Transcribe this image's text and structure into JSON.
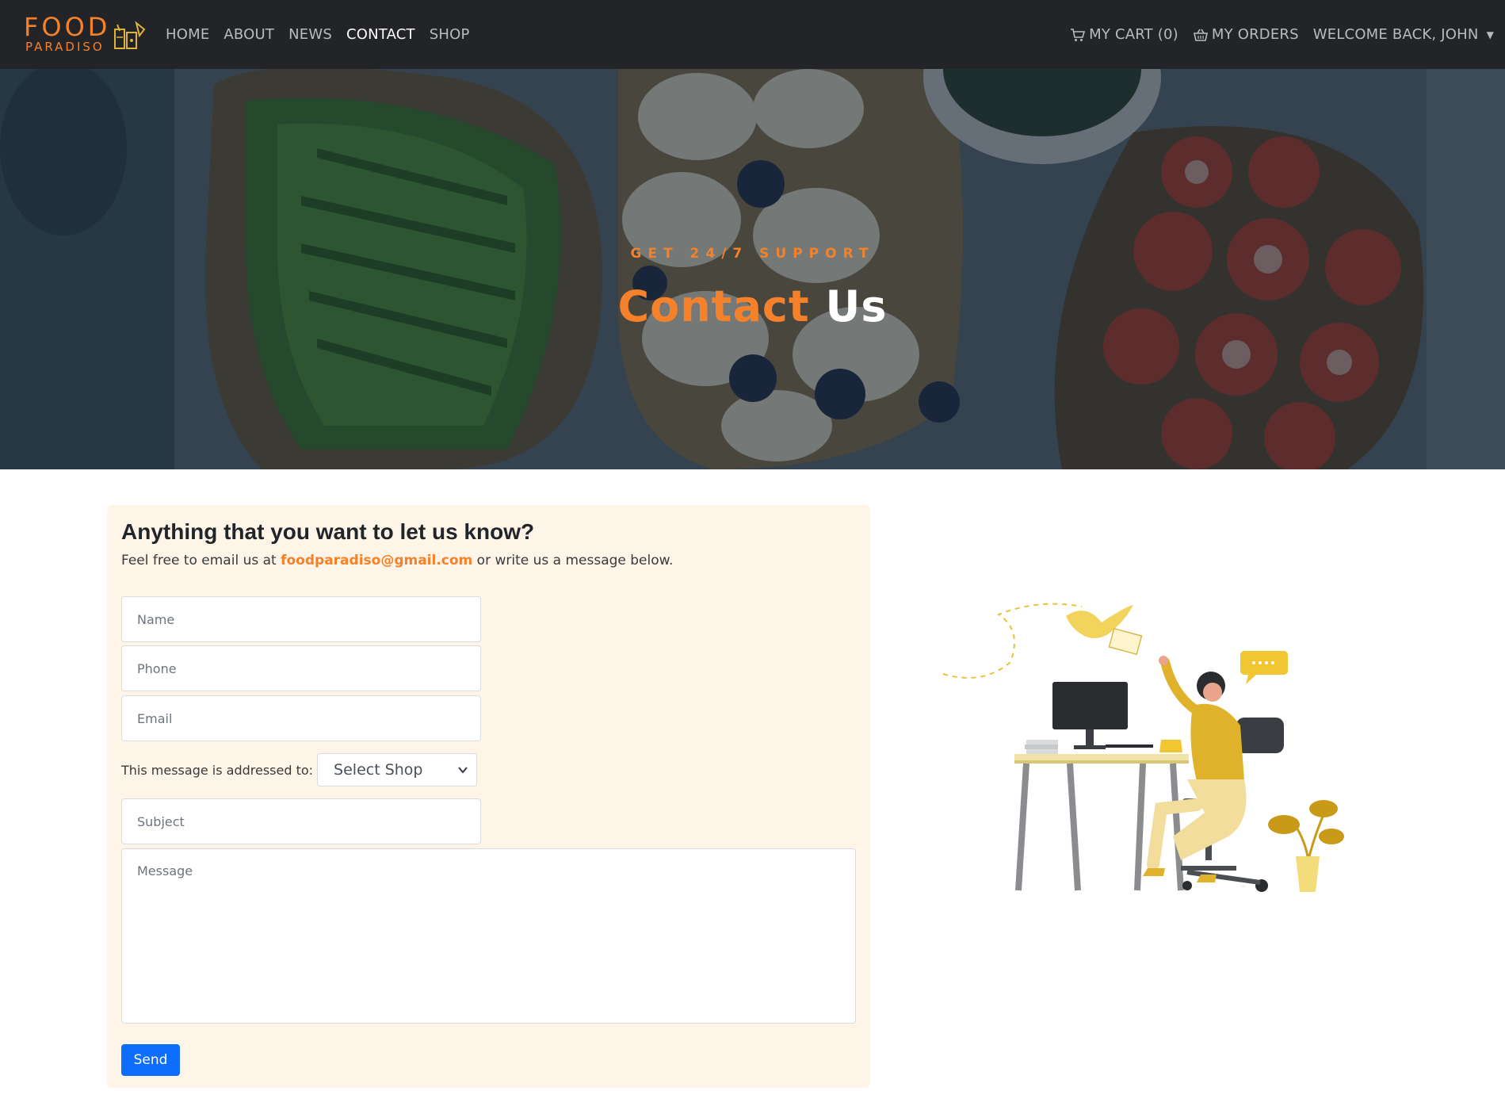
{
  "nav": {
    "logo_top": "FOOD",
    "logo_bottom": "PARADISO",
    "links": [
      {
        "label": "HOME"
      },
      {
        "label": "ABOUT"
      },
      {
        "label": "NEWS"
      },
      {
        "label": "CONTACT"
      },
      {
        "label": "SHOP"
      }
    ],
    "active_link": "CONTACT",
    "cart_label": "MY CART (0)",
    "orders_label": "MY ORDERS",
    "user_label": "WELCOME BACK, JOHN"
  },
  "hero": {
    "subtitle": "GET 24/7 SUPPORT",
    "title_part1": "Contact",
    "title_part2": "Us"
  },
  "contact": {
    "heading": "Anything that you want to let us know?",
    "intro_before": "Feel free to email us at ",
    "intro_email": "foodparadiso@gmail.com",
    "intro_after": " or write us a message below.",
    "name_placeholder": "Name",
    "phone_placeholder": "Phone",
    "email_placeholder": "Email",
    "address_label": "This message is addressed to:",
    "shop_select_value": "Select Shop",
    "subject_placeholder": "Subject",
    "message_placeholder": "Message",
    "send_label": "Send"
  },
  "colors": {
    "navbar_bg": "#222428",
    "accent": "#f5822a",
    "card_bg": "#fff4e8",
    "primary_button": "#0d6efd",
    "illustration_yellow": "#f2c630"
  },
  "icons": [
    "cart-icon",
    "basket-icon",
    "caret-down-icon",
    "chevron-down-icon",
    "logo-drinks-icon"
  ]
}
